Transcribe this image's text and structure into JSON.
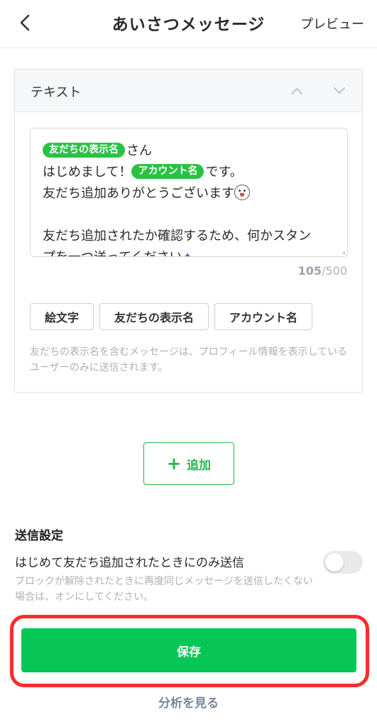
{
  "header": {
    "title": "あいさつメッセージ",
    "preview_label": "プレビュー",
    "back_icon": "chevron-left-icon"
  },
  "card": {
    "label": "テキスト",
    "message": {
      "line1_tag": "友だちの表示名",
      "line1_suffix": "さん",
      "line2_prefix": "はじめまして！",
      "line2_tag": "アカウント名",
      "line2_suffix": "です。",
      "line3": "友だち追加ありがとうございます",
      "line5": "友だち追加されたか確認するため、何かスタン",
      "line6": "プを一つ送ってください"
    },
    "counter": {
      "current": "105",
      "max": "/500"
    },
    "chips": [
      "絵文字",
      "友だちの表示名",
      "アカウント名"
    ],
    "note": "友だちの表示名を含むメッセージは、プロフィール情報を表示しているユーザーのみに送信されます。"
  },
  "add_button": {
    "plus": "+",
    "label": "追加"
  },
  "settings": {
    "title": "送信設定",
    "row_label": "はじめて友だち追加されたときにのみ送信",
    "toggle_on": false,
    "help": "ブロックが解除されたときに再度同じメッセージを送信したくない場合は、オンにしてください。"
  },
  "save_button": {
    "label": "保存"
  },
  "analytics_link": {
    "label": "分析を見る"
  },
  "colors": {
    "accent": "#06c755",
    "tag": "#2ac244",
    "highlight": "#ff2b2b"
  }
}
